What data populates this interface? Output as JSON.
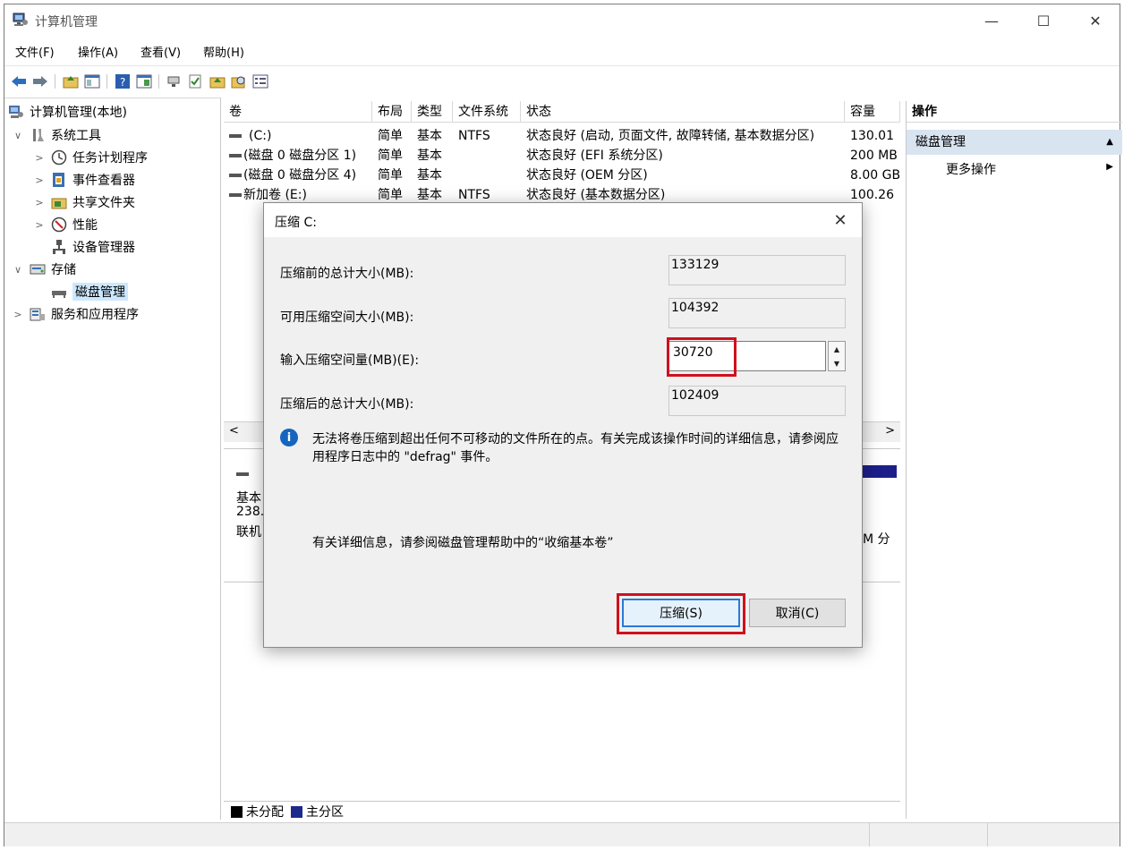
{
  "window": {
    "title": "计算机管理",
    "minimize": "—",
    "maximize": "☐",
    "close": "✕"
  },
  "menu": [
    "文件(F)",
    "操作(A)",
    "查看(V)",
    "帮助(H)"
  ],
  "tree": [
    {
      "label": "计算机管理(本地)",
      "caret": "",
      "icon": "computer-management-icon",
      "level": 0
    },
    {
      "label": "系统工具",
      "caret": "∨",
      "icon": "system-tools-icon",
      "level": 1
    },
    {
      "label": "任务计划程序",
      "caret": ">",
      "icon": "task-scheduler-icon",
      "level": 2
    },
    {
      "label": "事件查看器",
      "caret": ">",
      "icon": "event-viewer-icon",
      "level": 2
    },
    {
      "label": "共享文件夹",
      "caret": ">",
      "icon": "shared-folders-icon",
      "level": 2
    },
    {
      "label": "性能",
      "caret": ">",
      "icon": "performance-icon",
      "level": 2
    },
    {
      "label": "设备管理器",
      "caret": "",
      "icon": "device-manager-icon",
      "level": 2
    },
    {
      "label": "存储",
      "caret": "∨",
      "icon": "storage-icon",
      "level": 1
    },
    {
      "label": "磁盘管理",
      "caret": "",
      "icon": "disk-management-icon",
      "level": 2,
      "selected": true
    },
    {
      "label": "服务和应用程序",
      "caret": ">",
      "icon": "services-apps-icon",
      "level": 1
    }
  ],
  "volumes": {
    "headers": [
      "卷",
      "布局",
      "类型",
      "文件系统",
      "状态",
      "容量"
    ],
    "rows": [
      [
        "(C:)",
        "简单",
        "基本",
        "NTFS",
        "状态良好 (启动, 页面文件, 故障转储, 基本数据分区)",
        "130.01"
      ],
      [
        "(磁盘 0 磁盘分区 1)",
        "简单",
        "基本",
        "",
        "状态良好 (EFI 系统分区)",
        "200 MB"
      ],
      [
        "(磁盘 0 磁盘分区 4)",
        "简单",
        "基本",
        "",
        "状态良好 (OEM 分区)",
        "8.00 GB"
      ],
      [
        "新加卷 (E:)",
        "简单",
        "基本",
        "NTFS",
        "状态良好 (基本数据分区)",
        "100.26"
      ]
    ]
  },
  "disk": {
    "type": "基本",
    "size": "238.",
    "status": "联机",
    "right_text": "M 分"
  },
  "legend": [
    {
      "label": "未分配",
      "color": "#000000"
    },
    {
      "label": "主分区",
      "color": "#1c2a8c"
    }
  ],
  "actions": {
    "header": "操作",
    "section": "磁盘管理",
    "more": "更多操作"
  },
  "dialog": {
    "title": "压缩 C:",
    "fields": [
      {
        "label": "压缩前的总计大小(MB):",
        "value": "133129"
      },
      {
        "label": "可用压缩空间大小(MB):",
        "value": "104392"
      },
      {
        "label": "输入压缩空间量(MB)(E):",
        "value": "30720"
      },
      {
        "label": "压缩后的总计大小(MB):",
        "value": "102409"
      }
    ],
    "info": "无法将卷压缩到超出任何不可移动的文件所在的点。有关完成该操作时间的详细信息，请参阅应用程序日志中的 \"defrag\" 事件。",
    "more_info": "有关详细信息，请参阅磁盘管理帮助中的“收缩基本卷”",
    "shrink_button": "压缩(S)",
    "cancel_button": "取消(C)"
  },
  "colors": {
    "highlight": "#d0101c",
    "selection": "#cce8ff",
    "accent": "#2a7ad6"
  }
}
